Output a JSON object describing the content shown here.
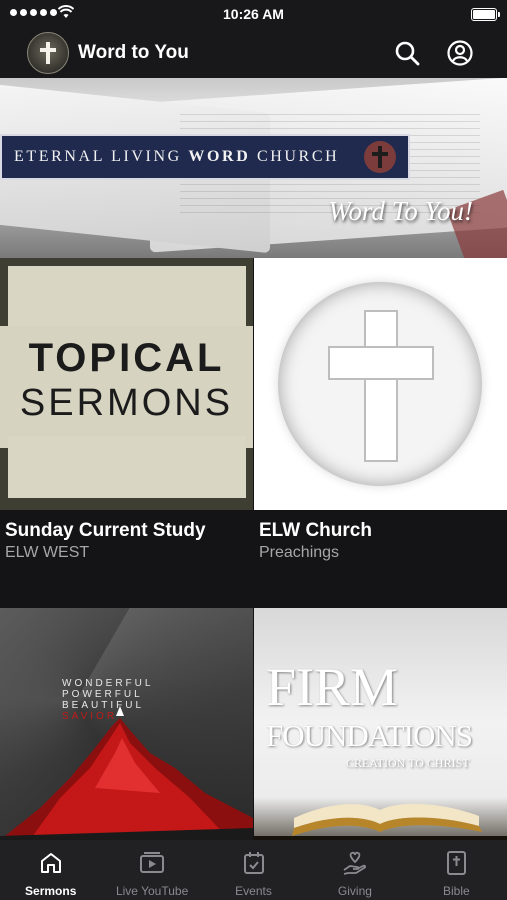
{
  "status_bar": {
    "time": "10:26 AM"
  },
  "header": {
    "app_title": "Word to You",
    "icons": [
      "logo-icon",
      "search-icon",
      "account-icon"
    ]
  },
  "banner": {
    "church_name_prefix": "ETERNAL LIVING",
    "church_name_bold": "WORD",
    "church_name_suffix": "CHURCH",
    "tagline": "Word To You!"
  },
  "cards": [
    {
      "title": "Sunday Current Study",
      "subtitle": "ELW WEST",
      "art_line1": "TOPICAL",
      "art_line2": "SERMONS"
    },
    {
      "title": "ELW Church",
      "subtitle": "Preachings"
    },
    {
      "art_words": [
        "WONDERFUL",
        "POWERFUL",
        "BEAUTIFUL",
        "SAVIOR"
      ]
    },
    {
      "art_line1": "FIRM",
      "art_line2": "FOUNDATIONS",
      "art_line3": "CREATION TO CHRIST"
    }
  ],
  "tabs": [
    {
      "label": "Sermons",
      "icon": "home-icon",
      "active": true
    },
    {
      "label": "Live YouTube",
      "icon": "video-icon",
      "active": false
    },
    {
      "label": "Events",
      "icon": "calendar-icon",
      "active": false
    },
    {
      "label": "Giving",
      "icon": "giving-icon",
      "active": false
    },
    {
      "label": "Bible",
      "icon": "bible-icon",
      "active": false
    }
  ],
  "colors": {
    "background": "#141416",
    "tabbar": "#212124",
    "banner_plate": "#1f2a4e",
    "accent_red": "#c21a1a"
  }
}
